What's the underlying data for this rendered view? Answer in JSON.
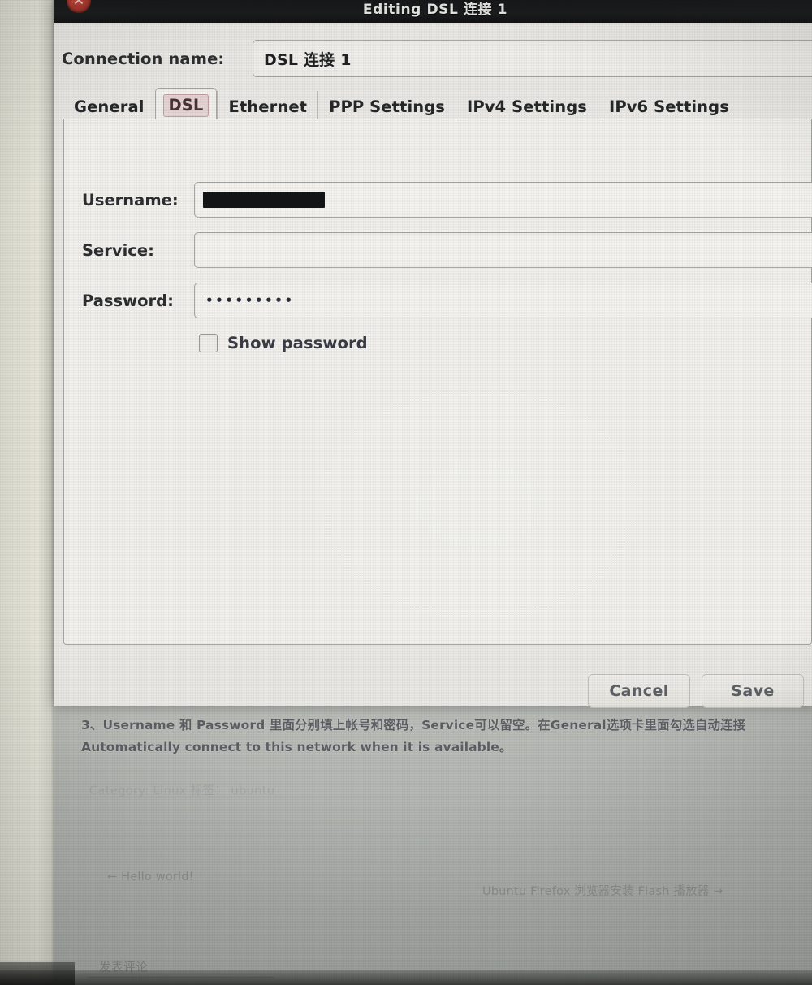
{
  "window": {
    "title": "Editing DSL 连接 1",
    "close_icon": "close-icon"
  },
  "connection": {
    "label": "Connection name:",
    "value": "DSL 连接 1",
    "placeholder": ""
  },
  "tabs": [
    {
      "label": "General",
      "active": false
    },
    {
      "label": "DSL",
      "active": true
    },
    {
      "label": "Ethernet",
      "active": false
    },
    {
      "label": "PPP Settings",
      "active": false
    },
    {
      "label": "IPv4 Settings",
      "active": false
    },
    {
      "label": "IPv6 Settings",
      "active": false
    }
  ],
  "form": {
    "username": {
      "label": "Username:",
      "value": "",
      "redacted": true,
      "placeholder": ""
    },
    "service": {
      "label": "Service:",
      "value": "",
      "placeholder": ""
    },
    "password": {
      "label": "Password:",
      "value": "•••••••••",
      "placeholder": ""
    },
    "show_password": {
      "label": "Show password",
      "checked": false
    }
  },
  "actions": {
    "cancel_label": "Cancel",
    "save_label": "Save"
  },
  "page": {
    "instruction": "3、Username 和 Password 里面分别填上帐号和密码，Service可以留空。在General选项卡里面勾选自动连接Automatically connect to this network when it is available。",
    "category_line": "Category: Linux 标签： ubuntu",
    "nav_prev": "← Hello world!",
    "nav_next": "Ubuntu Firefox 浏览器安装 Flash 播放器 →",
    "comment_link": "发表评论"
  },
  "colors": {
    "titlebar_bg": "#17181a",
    "close_button": "#c0392b",
    "dialog_bg": "#ecebe7",
    "panel_bg": "#f4f3ef",
    "active_tab_chip_bg": "#e8d6d6",
    "active_tab_chip_border": "#c9a0a2",
    "text_primary": "#2d2f31",
    "page_bg": "#c4c6bf"
  }
}
